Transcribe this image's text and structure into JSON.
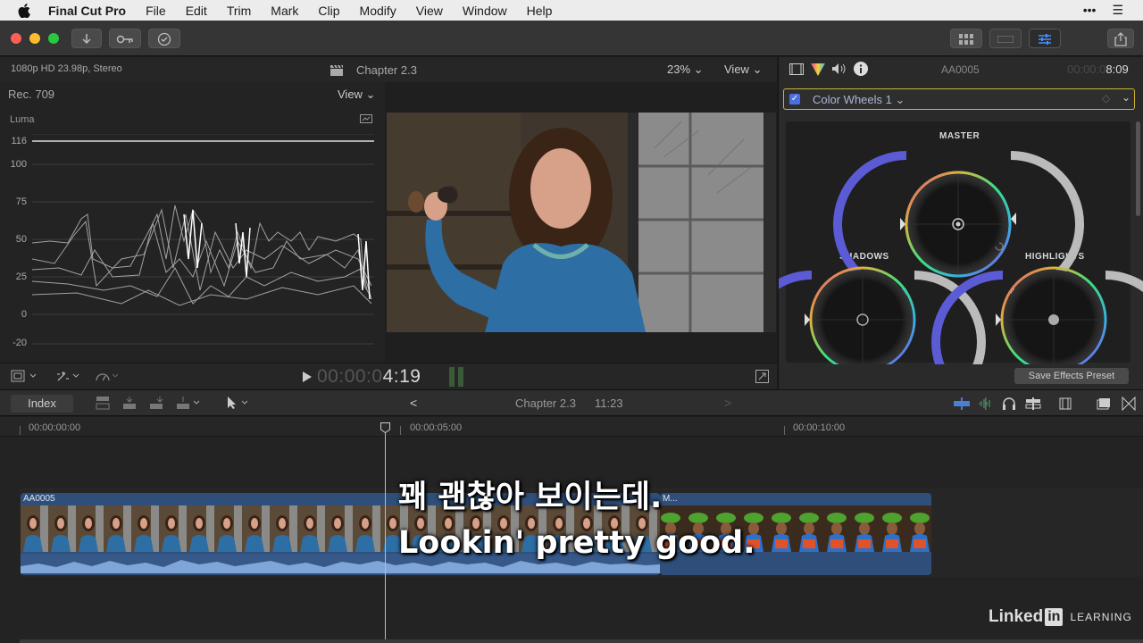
{
  "menubar": {
    "app_name": "Final Cut Pro",
    "menus": [
      "File",
      "Edit",
      "Trim",
      "Mark",
      "Clip",
      "Modify",
      "View",
      "Window",
      "Help"
    ]
  },
  "viewer": {
    "format": "1080p HD 23.98p, Stereo",
    "title": "Chapter 2.3",
    "zoom": "23%",
    "view_menu": "View",
    "timecode_dim": "00:00:0",
    "timecode_bright": "4:19"
  },
  "scope": {
    "color_space": "Rec. 709",
    "view_menu": "View",
    "mode": "Luma",
    "y_labels": [
      "116",
      "100",
      "75",
      "50",
      "25",
      "0",
      "-20"
    ]
  },
  "inspector": {
    "clip_name": "AA0005",
    "duration_dim": "00:00:0",
    "duration_bright": "8:09",
    "effect_name": "Color Wheels 1",
    "wheel_master": "MASTER",
    "wheel_shadows": "SHADOWS",
    "wheel_highlights": "HIGHLIGHTS",
    "save_preset": "Save Effects Preset"
  },
  "timeline": {
    "index_label": "Index",
    "project_name": "Chapter 2.3",
    "duration": "11:23",
    "ruler": [
      "00:00:00:00",
      "00:00:05:00",
      "00:00:10:00"
    ],
    "clip_label": "AA0005",
    "clip2_label": "M..."
  },
  "subtitles": {
    "korean": "꽤 괜찮아 보이는데.",
    "english": "Lookin' pretty good."
  },
  "watermark": {
    "brand": "Linked",
    "brand_in": "in",
    "learning": "LEARNING"
  },
  "colors": {
    "accent_blue": "#4a7fd4",
    "effect_border": "#c9b333",
    "clip_blue": "#2f4f7a"
  }
}
